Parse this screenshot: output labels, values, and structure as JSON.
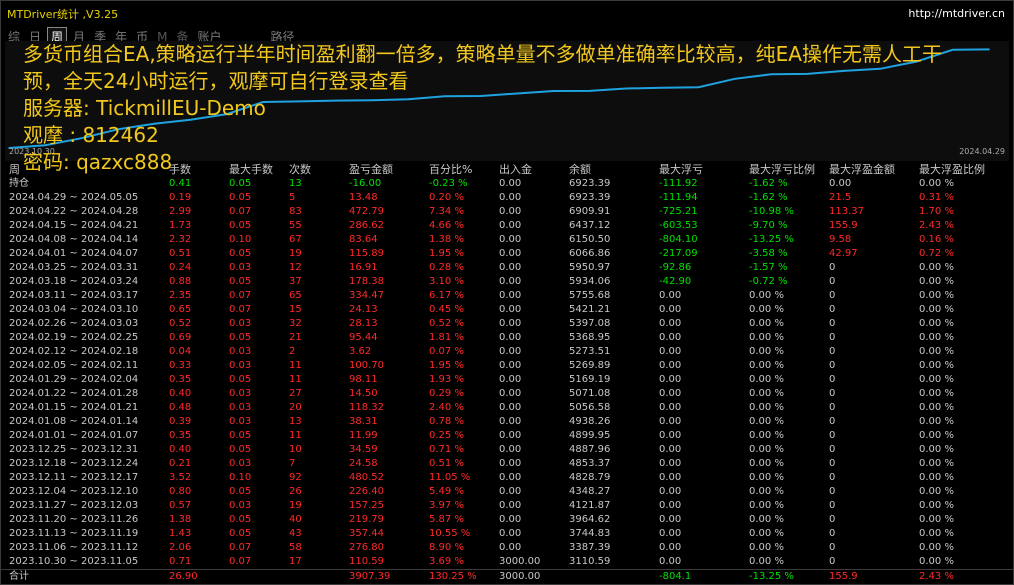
{
  "window": {
    "title": "MTDriver统计 ,V3.25",
    "url": "http://mtdriver.cn"
  },
  "tabs": [
    {
      "label": "综"
    },
    {
      "label": "日"
    },
    {
      "label": "周",
      "active": true
    },
    {
      "label": "月"
    },
    {
      "label": "季"
    },
    {
      "label": "年"
    },
    {
      "label": "币"
    },
    {
      "label": "M"
    },
    {
      "label": "备"
    },
    {
      "label": "账户"
    },
    {
      "label": "路径"
    }
  ],
  "overlay": {
    "line1": "多货币组合EA,策略运行半年时间盈利翻一倍多，策略单量不多做单准确率比较高，纯EA操作无需人工干",
    "line2": "预，全天24小时运行，观摩可自行登录查看",
    "server": "服务器: TickmillEU-Demo",
    "login": "观摩 : 812462",
    "password": "密码: qazxc888"
  },
  "chart_data": {
    "type": "line",
    "x_start": "2023.10.30",
    "x_end": "2024.04.29",
    "line_color": "#1fa2e0",
    "y": [
      3000,
      3110.59,
      3387.39,
      3744.83,
      3964.62,
      4121.87,
      4348.27,
      4828.79,
      4853.37,
      4887.96,
      4899.95,
      4938.26,
      5056.58,
      5071.08,
      5169.19,
      5269.89,
      5273.51,
      5368.95,
      5397.08,
      5421.21,
      5755.68,
      5934.06,
      5950.97,
      6066.86,
      6150.5,
      6437.12,
      6909.91,
      6923.39
    ]
  },
  "table": {
    "columns": [
      "周",
      "手数",
      "最大手数",
      "次数",
      "盈亏金额",
      "百分比%",
      "出入金",
      "余额",
      "最大浮亏",
      "最大浮亏比例",
      "最大浮盈金额",
      "最大浮盈比例"
    ],
    "holding": {
      "period": "持仓",
      "lots": "0.41",
      "max_lots": "0.05",
      "count": "13",
      "pnl": "-16.00",
      "pct": "-0.23 %",
      "deposit": "0.00",
      "balance": "6923.39",
      "max_dd": "-111.92",
      "max_dd_pct": "-1.62 %",
      "max_fp": "0.00",
      "max_fp_pct": "0.00 %"
    },
    "rows": [
      {
        "period": "2024.04.29 ~ 2024.05.05",
        "lots": "0.19",
        "max_lots": "0.05",
        "count": "5",
        "pnl": "13.48",
        "pct": "0.20 %",
        "deposit": "0.00",
        "balance": "6923.39",
        "max_dd": "-111.94",
        "max_dd_pct": "-1.62 %",
        "max_fp": "21.5",
        "max_fp_pct": "0.31 %"
      },
      {
        "period": "2024.04.22 ~ 2024.04.28",
        "lots": "2.99",
        "max_lots": "0.07",
        "count": "83",
        "pnl": "472.79",
        "pct": "7.34 %",
        "deposit": "0.00",
        "balance": "6909.91",
        "max_dd": "-725.21",
        "max_dd_pct": "-10.98 %",
        "max_fp": "113.37",
        "max_fp_pct": "1.70 %"
      },
      {
        "period": "2024.04.15 ~ 2024.04.21",
        "lots": "1.73",
        "max_lots": "0.05",
        "count": "55",
        "pnl": "286.62",
        "pct": "4.66 %",
        "deposit": "0.00",
        "balance": "6437.12",
        "max_dd": "-603.53",
        "max_dd_pct": "-9.70 %",
        "max_fp": "155.9",
        "max_fp_pct": "2.43 %"
      },
      {
        "period": "2024.04.08 ~ 2024.04.14",
        "lots": "2.32",
        "max_lots": "0.10",
        "count": "67",
        "pnl": "83.64",
        "pct": "1.38 %",
        "deposit": "0.00",
        "balance": "6150.50",
        "max_dd": "-804.10",
        "max_dd_pct": "-13.25 %",
        "max_fp": "9.58",
        "max_fp_pct": "0.16 %"
      },
      {
        "period": "2024.04.01 ~ 2024.04.07",
        "lots": "0.51",
        "max_lots": "0.05",
        "count": "19",
        "pnl": "115.89",
        "pct": "1.95 %",
        "deposit": "0.00",
        "balance": "6066.86",
        "max_dd": "-217.09",
        "max_dd_pct": "-3.58 %",
        "max_fp": "42.97",
        "max_fp_pct": "0.72 %"
      },
      {
        "period": "2024.03.25 ~ 2024.03.31",
        "lots": "0.24",
        "max_lots": "0.03",
        "count": "12",
        "pnl": "16.91",
        "pct": "0.28 %",
        "deposit": "0.00",
        "balance": "5950.97",
        "max_dd": "-92.86",
        "max_dd_pct": "-1.57 %",
        "max_fp": "0",
        "max_fp_pct": "0.00 %"
      },
      {
        "period": "2024.03.18 ~ 2024.03.24",
        "lots": "0.88",
        "max_lots": "0.05",
        "count": "37",
        "pnl": "178.38",
        "pct": "3.10 %",
        "deposit": "0.00",
        "balance": "5934.06",
        "max_dd": "-42.90",
        "max_dd_pct": "-0.72 %",
        "max_fp": "0",
        "max_fp_pct": "0.00 %"
      },
      {
        "period": "2024.03.11 ~ 2024.03.17",
        "lots": "2.35",
        "max_lots": "0.07",
        "count": "65",
        "pnl": "334.47",
        "pct": "6.17 %",
        "deposit": "0.00",
        "balance": "5755.68",
        "max_dd": "0.00",
        "max_dd_pct": "0.00 %",
        "max_fp": "0",
        "max_fp_pct": "0.00 %"
      },
      {
        "period": "2024.03.04 ~ 2024.03.10",
        "lots": "0.65",
        "max_lots": "0.07",
        "count": "15",
        "pnl": "24.13",
        "pct": "0.45 %",
        "deposit": "0.00",
        "balance": "5421.21",
        "max_dd": "0.00",
        "max_dd_pct": "0.00 %",
        "max_fp": "0",
        "max_fp_pct": "0.00 %"
      },
      {
        "period": "2024.02.26 ~ 2024.03.03",
        "lots": "0.52",
        "max_lots": "0.03",
        "count": "32",
        "pnl": "28.13",
        "pct": "0.52 %",
        "deposit": "0.00",
        "balance": "5397.08",
        "max_dd": "0.00",
        "max_dd_pct": "0.00 %",
        "max_fp": "0",
        "max_fp_pct": "0.00 %"
      },
      {
        "period": "2024.02.19 ~ 2024.02.25",
        "lots": "0.69",
        "max_lots": "0.05",
        "count": "21",
        "pnl": "95.44",
        "pct": "1.81 %",
        "deposit": "0.00",
        "balance": "5368.95",
        "max_dd": "0.00",
        "max_dd_pct": "0.00 %",
        "max_fp": "0",
        "max_fp_pct": "0.00 %"
      },
      {
        "period": "2024.02.12 ~ 2024.02.18",
        "lots": "0.04",
        "max_lots": "0.03",
        "count": "2",
        "pnl": "3.62",
        "pct": "0.07 %",
        "deposit": "0.00",
        "balance": "5273.51",
        "max_dd": "0.00",
        "max_dd_pct": "0.00 %",
        "max_fp": "0",
        "max_fp_pct": "0.00 %"
      },
      {
        "period": "2024.02.05 ~ 2024.02.11",
        "lots": "0.33",
        "max_lots": "0.03",
        "count": "11",
        "pnl": "100.70",
        "pct": "1.95 %",
        "deposit": "0.00",
        "balance": "5269.89",
        "max_dd": "0.00",
        "max_dd_pct": "0.00 %",
        "max_fp": "0",
        "max_fp_pct": "0.00 %"
      },
      {
        "period": "2024.01.29 ~ 2024.02.04",
        "lots": "0.35",
        "max_lots": "0.05",
        "count": "11",
        "pnl": "98.11",
        "pct": "1.93 %",
        "deposit": "0.00",
        "balance": "5169.19",
        "max_dd": "0.00",
        "max_dd_pct": "0.00 %",
        "max_fp": "0",
        "max_fp_pct": "0.00 %"
      },
      {
        "period": "2024.01.22 ~ 2024.01.28",
        "lots": "0.40",
        "max_lots": "0.03",
        "count": "27",
        "pnl": "14.50",
        "pct": "0.29 %",
        "deposit": "0.00",
        "balance": "5071.08",
        "max_dd": "0.00",
        "max_dd_pct": "0.00 %",
        "max_fp": "0",
        "max_fp_pct": "0.00 %"
      },
      {
        "period": "2024.01.15 ~ 2024.01.21",
        "lots": "0.48",
        "max_lots": "0.03",
        "count": "20",
        "pnl": "118.32",
        "pct": "2.40 %",
        "deposit": "0.00",
        "balance": "5056.58",
        "max_dd": "0.00",
        "max_dd_pct": "0.00 %",
        "max_fp": "0",
        "max_fp_pct": "0.00 %"
      },
      {
        "period": "2024.01.08 ~ 2024.01.14",
        "lots": "0.39",
        "max_lots": "0.03",
        "count": "13",
        "pnl": "38.31",
        "pct": "0.78 %",
        "deposit": "0.00",
        "balance": "4938.26",
        "max_dd": "0.00",
        "max_dd_pct": "0.00 %",
        "max_fp": "0",
        "max_fp_pct": "0.00 %"
      },
      {
        "period": "2024.01.01 ~ 2024.01.07",
        "lots": "0.35",
        "max_lots": "0.05",
        "count": "11",
        "pnl": "11.99",
        "pct": "0.25 %",
        "deposit": "0.00",
        "balance": "4899.95",
        "max_dd": "0.00",
        "max_dd_pct": "0.00 %",
        "max_fp": "0",
        "max_fp_pct": "0.00 %"
      },
      {
        "period": "2023.12.25 ~ 2023.12.31",
        "lots": "0.40",
        "max_lots": "0.05",
        "count": "10",
        "pnl": "34.59",
        "pct": "0.71 %",
        "deposit": "0.00",
        "balance": "4887.96",
        "max_dd": "0.00",
        "max_dd_pct": "0.00 %",
        "max_fp": "0",
        "max_fp_pct": "0.00 %"
      },
      {
        "period": "2023.12.18 ~ 2023.12.24",
        "lots": "0.21",
        "max_lots": "0.03",
        "count": "7",
        "pnl": "24.58",
        "pct": "0.51 %",
        "deposit": "0.00",
        "balance": "4853.37",
        "max_dd": "0.00",
        "max_dd_pct": "0.00 %",
        "max_fp": "0",
        "max_fp_pct": "0.00 %"
      },
      {
        "period": "2023.12.11 ~ 2023.12.17",
        "lots": "3.52",
        "max_lots": "0.10",
        "count": "92",
        "pnl": "480.52",
        "pct": "11.05 %",
        "deposit": "0.00",
        "balance": "4828.79",
        "max_dd": "0.00",
        "max_dd_pct": "0.00 %",
        "max_fp": "0",
        "max_fp_pct": "0.00 %"
      },
      {
        "period": "2023.12.04 ~ 2023.12.10",
        "lots": "0.80",
        "max_lots": "0.05",
        "count": "26",
        "pnl": "226.40",
        "pct": "5.49 %",
        "deposit": "0.00",
        "balance": "4348.27",
        "max_dd": "0.00",
        "max_dd_pct": "0.00 %",
        "max_fp": "0",
        "max_fp_pct": "0.00 %"
      },
      {
        "period": "2023.11.27 ~ 2023.12.03",
        "lots": "0.57",
        "max_lots": "0.03",
        "count": "19",
        "pnl": "157.25",
        "pct": "3.97 %",
        "deposit": "0.00",
        "balance": "4121.87",
        "max_dd": "0.00",
        "max_dd_pct": "0.00 %",
        "max_fp": "0",
        "max_fp_pct": "0.00 %"
      },
      {
        "period": "2023.11.20 ~ 2023.11.26",
        "lots": "1.38",
        "max_lots": "0.05",
        "count": "40",
        "pnl": "219.79",
        "pct": "5.87 %",
        "deposit": "0.00",
        "balance": "3964.62",
        "max_dd": "0.00",
        "max_dd_pct": "0.00 %",
        "max_fp": "0",
        "max_fp_pct": "0.00 %"
      },
      {
        "period": "2023.11.13 ~ 2023.11.19",
        "lots": "1.43",
        "max_lots": "0.05",
        "count": "43",
        "pnl": "357.44",
        "pct": "10.55 %",
        "deposit": "0.00",
        "balance": "3744.83",
        "max_dd": "0.00",
        "max_dd_pct": "0.00 %",
        "max_fp": "0",
        "max_fp_pct": "0.00 %"
      },
      {
        "period": "2023.11.06 ~ 2023.11.12",
        "lots": "2.06",
        "max_lots": "0.07",
        "count": "58",
        "pnl": "276.80",
        "pct": "8.90 %",
        "deposit": "0.00",
        "balance": "3387.39",
        "max_dd": "0.00",
        "max_dd_pct": "0.00 %",
        "max_fp": "0",
        "max_fp_pct": "0.00 %"
      },
      {
        "period": "2023.10.30 ~ 2023.11.05",
        "lots": "0.71",
        "max_lots": "0.07",
        "count": "17",
        "pnl": "110.59",
        "pct": "3.69 %",
        "deposit": "3000.00",
        "balance": "3110.59",
        "max_dd": "0.00",
        "max_dd_pct": "0.00 %",
        "max_fp": "0",
        "max_fp_pct": "0.00 %"
      }
    ],
    "total": {
      "period": "合计",
      "lots": "26.90",
      "max_lots": "",
      "count": "",
      "pnl": "3907.39",
      "pct": "130.25 %",
      "deposit": "3000.00",
      "balance": "",
      "max_dd": "-804.1",
      "max_dd_pct": "-13.25 %",
      "max_fp": "155.9",
      "max_fp_pct": "2.43 %"
    }
  },
  "colors": {
    "profit": "#ff2a2a",
    "loss": "#00e000",
    "overlay_text": "#f2c81c"
  }
}
